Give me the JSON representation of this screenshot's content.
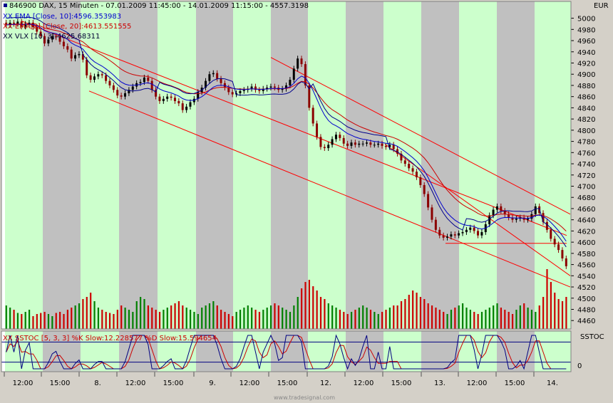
{
  "header": {
    "line1": "846900  DAX, 15 Minuten - 07.01.2009 11:45:00 - 14.01.2009 11:15:00 - 4557.3198",
    "line2": "XX EMA [Close, 10]:4596.353983",
    "line3": "XX EMA[2] [Close, 20]:4613.551555",
    "line4": "XX VLX [10, 3]:4625.68311"
  },
  "currency_label": "EUR",
  "stoch_label": "XX SSTOC [5, 3, 3] %K Slow:12.228577 %D Slow:15.594654",
  "stoch_panel_title": "SSTOC",
  "stoch_axis_zero": "0",
  "watermark": "www.tradesignal.com",
  "colors": {
    "bull": "#000000",
    "bear": "#8b0000",
    "ema10": "#0000cd",
    "ema20": "#cc0000",
    "vlx": "#00008b",
    "channel": "#ff0000",
    "vol_up": "#008000",
    "vol_down": "#cc0000",
    "band_green": "#ccffcc",
    "band_gray": "#c0c0c0"
  },
  "chart_data": {
    "type": "candlestick",
    "title": "846900  DAX, 15 Minuten - 07.01.2009 11:45:00 - 14.01.2009 11:15:00 - 4557.3198",
    "ylabel": "EUR",
    "ylim": [
      4445,
      5030
    ],
    "y_ticks": [
      4460,
      4480,
      4500,
      4520,
      4540,
      4560,
      4580,
      4600,
      4620,
      4640,
      4660,
      4680,
      4700,
      4720,
      4740,
      4760,
      4780,
      4800,
      4820,
      4840,
      4860,
      4880,
      4900,
      4920,
      4940,
      4960,
      4980,
      5000
    ],
    "x_tick_labels": [
      "12:00",
      "15:00",
      "8.",
      "12:00",
      "15:00",
      "9.",
      "12:00",
      "15:00",
      "12.",
      "12:00",
      "15:00",
      "13.",
      "12:00",
      "15:00",
      "14."
    ],
    "close": [
      4988,
      4992,
      4990,
      4994,
      4985,
      4990,
      4992,
      4984,
      4976,
      4968,
      4955,
      4962,
      4968,
      4966,
      4958,
      4950,
      4944,
      4928,
      4934,
      4936,
      4926,
      4898,
      4890,
      4896,
      4900,
      4898,
      4888,
      4880,
      4872,
      4862,
      4860,
      4866,
      4872,
      4878,
      4884,
      4886,
      4894,
      4888,
      4872,
      4860,
      4852,
      4856,
      4860,
      4858,
      4852,
      4848,
      4836,
      4842,
      4850,
      4856,
      4868,
      4876,
      4888,
      4900,
      4902,
      4892,
      4884,
      4876,
      4868,
      4864,
      4866,
      4870,
      4872,
      4874,
      4878,
      4872,
      4870,
      4874,
      4876,
      4878,
      4876,
      4872,
      4874,
      4880,
      4890,
      4910,
      4928,
      4918,
      4880,
      4840,
      4812,
      4788,
      4770,
      4768,
      4774,
      4784,
      4792,
      4786,
      4776,
      4772,
      4778,
      4774,
      4776,
      4776,
      4778,
      4774,
      4774,
      4776,
      4772,
      4770,
      4774,
      4766,
      4758,
      4746,
      4740,
      4732,
      4726,
      4716,
      4702,
      4686,
      4662,
      4640,
      4622,
      4612,
      4608,
      4610,
      4614,
      4612,
      4616,
      4618,
      4622,
      4626,
      4620,
      4612,
      4618,
      4632,
      4648,
      4658,
      4664,
      4656,
      4650,
      4644,
      4640,
      4642,
      4644,
      4640,
      4642,
      4650,
      4664,
      4652,
      4636,
      4622,
      4606,
      4596,
      4586,
      4571,
      4557
    ],
    "volume": [
      22,
      20,
      18,
      15,
      14,
      16,
      18,
      12,
      14,
      15,
      16,
      14,
      12,
      15,
      16,
      14,
      18,
      20,
      22,
      24,
      28,
      30,
      34,
      26,
      20,
      18,
      16,
      15,
      14,
      18,
      22,
      20,
      18,
      16,
      26,
      30,
      28,
      22,
      20,
      18,
      16,
      18,
      20,
      22,
      24,
      26,
      22,
      20,
      18,
      16,
      14,
      20,
      22,
      24,
      26,
      22,
      18,
      16,
      14,
      12,
      16,
      18,
      20,
      22,
      20,
      18,
      16,
      18,
      20,
      22,
      24,
      22,
      20,
      18,
      16,
      22,
      30,
      38,
      44,
      46,
      40,
      36,
      30,
      28,
      24,
      22,
      20,
      18,
      16,
      14,
      16,
      18,
      20,
      22,
      20,
      18,
      16,
      14,
      16,
      18,
      20,
      22,
      22,
      26,
      28,
      32,
      36,
      34,
      30,
      28,
      24,
      22,
      20,
      18,
      16,
      14,
      18,
      20,
      22,
      24,
      20,
      18,
      16,
      14,
      16,
      18,
      20,
      22,
      24,
      20,
      18,
      16,
      14,
      18,
      22,
      24,
      20,
      18,
      16,
      22,
      30,
      56,
      44,
      34,
      28,
      26,
      30
    ]
  }
}
